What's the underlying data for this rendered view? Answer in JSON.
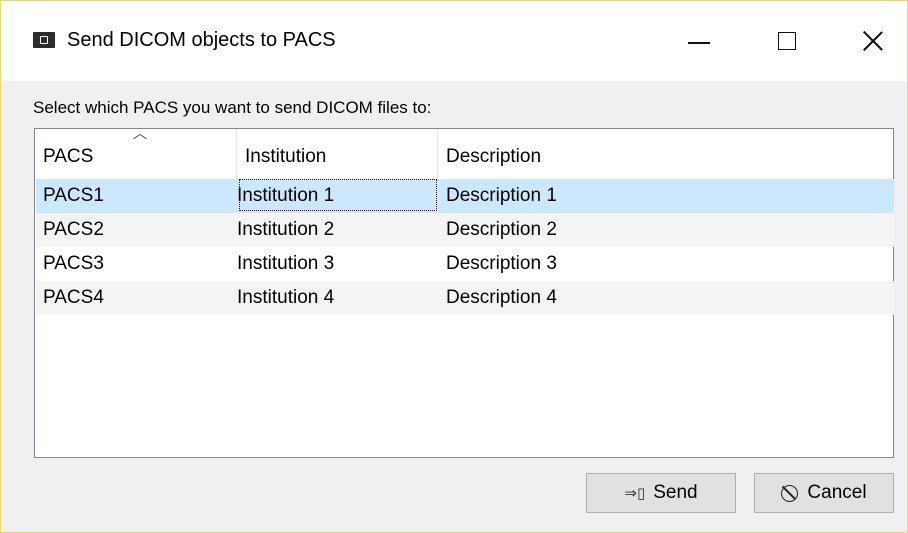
{
  "window": {
    "title": "Send DICOM objects to PACS",
    "icon": "app-icon"
  },
  "prompt": "Select which PACS you want to send DICOM files to:",
  "table": {
    "columns": [
      "PACS",
      "Institution",
      "Description"
    ],
    "sorted_column": "PACS",
    "rows": [
      {
        "pacs": "PACS1",
        "institution": "Institution 1",
        "description": "Description 1",
        "selected": true
      },
      {
        "pacs": "PACS2",
        "institution": "Institution 2",
        "description": "Description 2",
        "selected": false
      },
      {
        "pacs": "PACS3",
        "institution": "Institution 3",
        "description": "Description 3",
        "selected": false
      },
      {
        "pacs": "PACS4",
        "institution": "Institution 4",
        "description": "Description 4",
        "selected": false
      }
    ]
  },
  "buttons": {
    "send": {
      "label": "Send",
      "icon": "send-icon"
    },
    "cancel": {
      "label": "Cancel",
      "icon": "cancel-icon"
    }
  },
  "colors": {
    "selection": "#cce8ff",
    "window_border": "#e8d96a"
  }
}
